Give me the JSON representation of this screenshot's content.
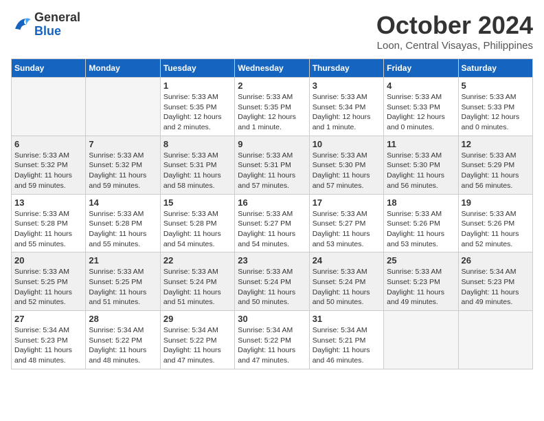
{
  "header": {
    "logo": {
      "line1": "General",
      "line2": "Blue"
    },
    "month": "October 2024",
    "location": "Loon, Central Visayas, Philippines"
  },
  "weekdays": [
    "Sunday",
    "Monday",
    "Tuesday",
    "Wednesday",
    "Thursday",
    "Friday",
    "Saturday"
  ],
  "weeks": [
    [
      {
        "day": "",
        "empty": true
      },
      {
        "day": "",
        "empty": true
      },
      {
        "day": "1",
        "sunrise": "Sunrise: 5:33 AM",
        "sunset": "Sunset: 5:35 PM",
        "daylight": "Daylight: 12 hours and 2 minutes."
      },
      {
        "day": "2",
        "sunrise": "Sunrise: 5:33 AM",
        "sunset": "Sunset: 5:35 PM",
        "daylight": "Daylight: 12 hours and 1 minute."
      },
      {
        "day": "3",
        "sunrise": "Sunrise: 5:33 AM",
        "sunset": "Sunset: 5:34 PM",
        "daylight": "Daylight: 12 hours and 1 minute."
      },
      {
        "day": "4",
        "sunrise": "Sunrise: 5:33 AM",
        "sunset": "Sunset: 5:33 PM",
        "daylight": "Daylight: 12 hours and 0 minutes."
      },
      {
        "day": "5",
        "sunrise": "Sunrise: 5:33 AM",
        "sunset": "Sunset: 5:33 PM",
        "daylight": "Daylight: 12 hours and 0 minutes."
      }
    ],
    [
      {
        "day": "6",
        "sunrise": "Sunrise: 5:33 AM",
        "sunset": "Sunset: 5:32 PM",
        "daylight": "Daylight: 11 hours and 59 minutes."
      },
      {
        "day": "7",
        "sunrise": "Sunrise: 5:33 AM",
        "sunset": "Sunset: 5:32 PM",
        "daylight": "Daylight: 11 hours and 59 minutes."
      },
      {
        "day": "8",
        "sunrise": "Sunrise: 5:33 AM",
        "sunset": "Sunset: 5:31 PM",
        "daylight": "Daylight: 11 hours and 58 minutes."
      },
      {
        "day": "9",
        "sunrise": "Sunrise: 5:33 AM",
        "sunset": "Sunset: 5:31 PM",
        "daylight": "Daylight: 11 hours and 57 minutes."
      },
      {
        "day": "10",
        "sunrise": "Sunrise: 5:33 AM",
        "sunset": "Sunset: 5:30 PM",
        "daylight": "Daylight: 11 hours and 57 minutes."
      },
      {
        "day": "11",
        "sunrise": "Sunrise: 5:33 AM",
        "sunset": "Sunset: 5:30 PM",
        "daylight": "Daylight: 11 hours and 56 minutes."
      },
      {
        "day": "12",
        "sunrise": "Sunrise: 5:33 AM",
        "sunset": "Sunset: 5:29 PM",
        "daylight": "Daylight: 11 hours and 56 minutes."
      }
    ],
    [
      {
        "day": "13",
        "sunrise": "Sunrise: 5:33 AM",
        "sunset": "Sunset: 5:28 PM",
        "daylight": "Daylight: 11 hours and 55 minutes."
      },
      {
        "day": "14",
        "sunrise": "Sunrise: 5:33 AM",
        "sunset": "Sunset: 5:28 PM",
        "daylight": "Daylight: 11 hours and 55 minutes."
      },
      {
        "day": "15",
        "sunrise": "Sunrise: 5:33 AM",
        "sunset": "Sunset: 5:28 PM",
        "daylight": "Daylight: 11 hours and 54 minutes."
      },
      {
        "day": "16",
        "sunrise": "Sunrise: 5:33 AM",
        "sunset": "Sunset: 5:27 PM",
        "daylight": "Daylight: 11 hours and 54 minutes."
      },
      {
        "day": "17",
        "sunrise": "Sunrise: 5:33 AM",
        "sunset": "Sunset: 5:27 PM",
        "daylight": "Daylight: 11 hours and 53 minutes."
      },
      {
        "day": "18",
        "sunrise": "Sunrise: 5:33 AM",
        "sunset": "Sunset: 5:26 PM",
        "daylight": "Daylight: 11 hours and 53 minutes."
      },
      {
        "day": "19",
        "sunrise": "Sunrise: 5:33 AM",
        "sunset": "Sunset: 5:26 PM",
        "daylight": "Daylight: 11 hours and 52 minutes."
      }
    ],
    [
      {
        "day": "20",
        "sunrise": "Sunrise: 5:33 AM",
        "sunset": "Sunset: 5:25 PM",
        "daylight": "Daylight: 11 hours and 52 minutes."
      },
      {
        "day": "21",
        "sunrise": "Sunrise: 5:33 AM",
        "sunset": "Sunset: 5:25 PM",
        "daylight": "Daylight: 11 hours and 51 minutes."
      },
      {
        "day": "22",
        "sunrise": "Sunrise: 5:33 AM",
        "sunset": "Sunset: 5:24 PM",
        "daylight": "Daylight: 11 hours and 51 minutes."
      },
      {
        "day": "23",
        "sunrise": "Sunrise: 5:33 AM",
        "sunset": "Sunset: 5:24 PM",
        "daylight": "Daylight: 11 hours and 50 minutes."
      },
      {
        "day": "24",
        "sunrise": "Sunrise: 5:33 AM",
        "sunset": "Sunset: 5:24 PM",
        "daylight": "Daylight: 11 hours and 50 minutes."
      },
      {
        "day": "25",
        "sunrise": "Sunrise: 5:33 AM",
        "sunset": "Sunset: 5:23 PM",
        "daylight": "Daylight: 11 hours and 49 minutes."
      },
      {
        "day": "26",
        "sunrise": "Sunrise: 5:34 AM",
        "sunset": "Sunset: 5:23 PM",
        "daylight": "Daylight: 11 hours and 49 minutes."
      }
    ],
    [
      {
        "day": "27",
        "sunrise": "Sunrise: 5:34 AM",
        "sunset": "Sunset: 5:23 PM",
        "daylight": "Daylight: 11 hours and 48 minutes."
      },
      {
        "day": "28",
        "sunrise": "Sunrise: 5:34 AM",
        "sunset": "Sunset: 5:22 PM",
        "daylight": "Daylight: 11 hours and 48 minutes."
      },
      {
        "day": "29",
        "sunrise": "Sunrise: 5:34 AM",
        "sunset": "Sunset: 5:22 PM",
        "daylight": "Daylight: 11 hours and 47 minutes."
      },
      {
        "day": "30",
        "sunrise": "Sunrise: 5:34 AM",
        "sunset": "Sunset: 5:22 PM",
        "daylight": "Daylight: 11 hours and 47 minutes."
      },
      {
        "day": "31",
        "sunrise": "Sunrise: 5:34 AM",
        "sunset": "Sunset: 5:21 PM",
        "daylight": "Daylight: 11 hours and 46 minutes."
      },
      {
        "day": "",
        "empty": true
      },
      {
        "day": "",
        "empty": true
      }
    ]
  ]
}
